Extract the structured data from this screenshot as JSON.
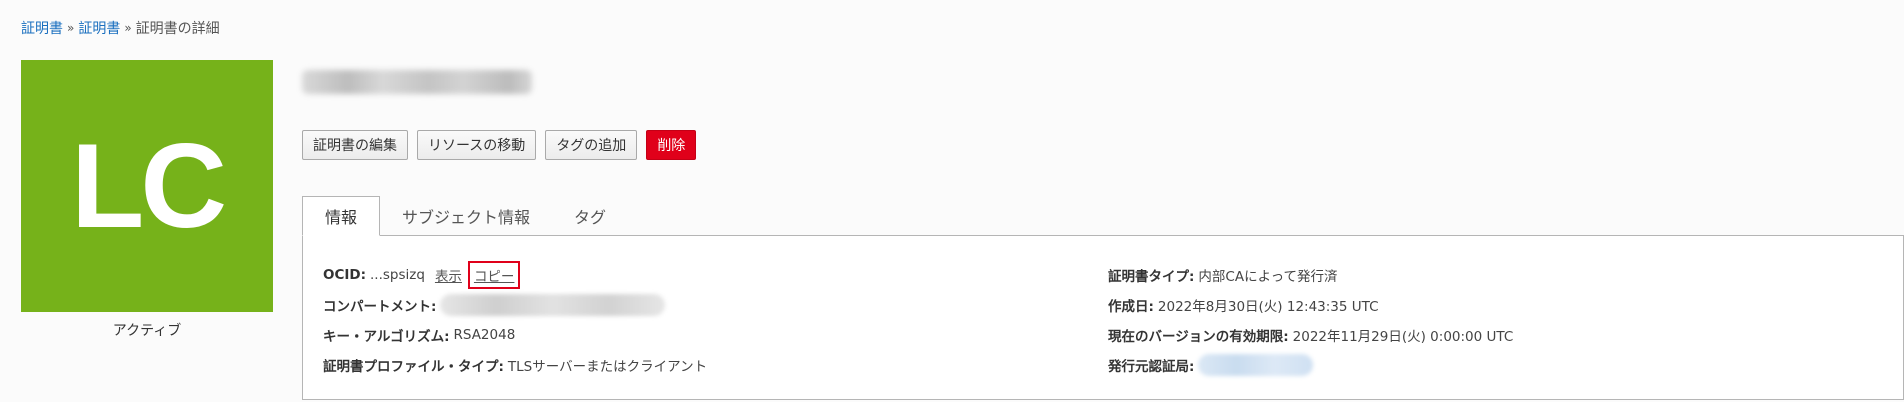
{
  "breadcrumb": {
    "item1": "証明書",
    "item2": "証明書",
    "current": "証明書の詳細",
    "separator": "»"
  },
  "resource": {
    "initials": "LC",
    "status": "アクティブ",
    "tile_color": "#76b21a"
  },
  "actions": {
    "edit": "証明書の編集",
    "move": "リソースの移動",
    "add_tag": "タグの追加",
    "delete": "削除",
    "delete_color": "#e0001a"
  },
  "tabs": {
    "info": "情報",
    "subject": "サブジェクト情報",
    "tags": "タグ"
  },
  "info": {
    "ocid_label": "OCID:",
    "ocid_value": "...spsizq",
    "show_link": "表示",
    "copy_link": "コピー",
    "compartment_label": "コンパートメント:",
    "key_algo_label": "キー・アルゴリズム:",
    "key_algo_value": "RSA2048",
    "profile_label": "証明書プロファイル・タイプ:",
    "profile_value": "TLSサーバーまたはクライアント",
    "cert_type_label": "証明書タイプ:",
    "cert_type_value": "内部CAによって発行済",
    "created_label": "作成日:",
    "created_value": "2022年8月30日(火) 12:43:35 UTC",
    "validity_label": "現在のバージョンの有効期限:",
    "validity_value": "2022年11月29日(火) 0:00:00 UTC",
    "issuer_label": "発行元認証局:"
  }
}
